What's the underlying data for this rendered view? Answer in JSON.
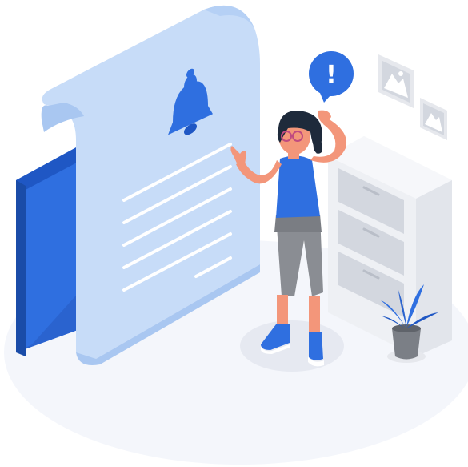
{
  "scene": {
    "colors": {
      "primary": "#2f6fe0",
      "primary_dark": "#1f57c4",
      "paper": "#c7dcf8",
      "paper_edge": "#a9c7f1",
      "floor": "#f4f6fb",
      "cabinet": "#eef0f4",
      "cabinet_drawer": "#d3d7df",
      "skin": "#f3967a",
      "hair": "#1e2a3b",
      "pants": "#8a8d93",
      "shoe": "#2f6fe0",
      "pot": "#7b7f86"
    },
    "speech_bubble": {
      "symbol": "!"
    },
    "icons": [
      "bell-icon",
      "exclamation-icon",
      "picture-frame-icon",
      "plant-icon"
    ]
  }
}
